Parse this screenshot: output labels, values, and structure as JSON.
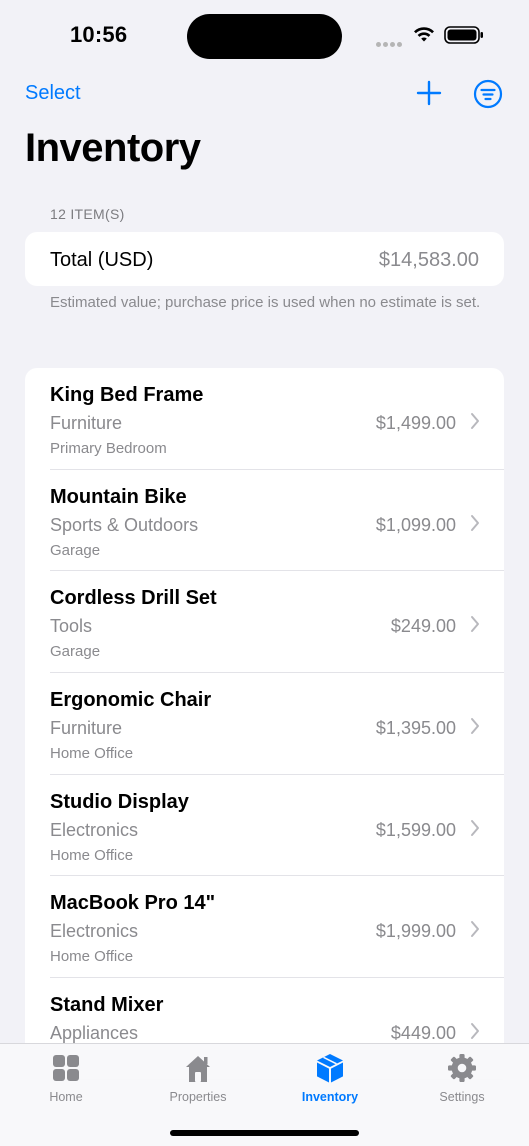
{
  "status_bar": {
    "time": "10:56"
  },
  "nav": {
    "select_label": "Select",
    "title": "Inventory"
  },
  "summary": {
    "count_label": "12 ITEM(S)",
    "total_label": "Total (USD)",
    "total_value": "$14,583.00",
    "footnote": "Estimated value; purchase price is used when no estimate is set."
  },
  "items": [
    {
      "name": "King Bed Frame",
      "category": "Furniture",
      "location": "Primary Bedroom",
      "price": "$1,499.00"
    },
    {
      "name": "Mountain Bike",
      "category": "Sports & Outdoors",
      "location": "Garage",
      "price": "$1,099.00"
    },
    {
      "name": "Cordless Drill Set",
      "category": "Tools",
      "location": "Garage",
      "price": "$249.00"
    },
    {
      "name": "Ergonomic Chair",
      "category": "Furniture",
      "location": "Home Office",
      "price": "$1,395.00"
    },
    {
      "name": "Studio Display",
      "category": "Electronics",
      "location": "Home Office",
      "price": "$1,599.00"
    },
    {
      "name": "MacBook Pro 14\"",
      "category": "Electronics",
      "location": "Home Office",
      "price": "$1,999.00"
    },
    {
      "name": "Stand Mixer",
      "category": "Appliances",
      "location": "",
      "price": "$449.00"
    }
  ],
  "tabs": [
    {
      "label": "Home",
      "icon": "grid-icon",
      "active": false
    },
    {
      "label": "Properties",
      "icon": "house-icon",
      "active": false
    },
    {
      "label": "Inventory",
      "icon": "shipping-box-icon",
      "active": true
    },
    {
      "label": "Settings",
      "icon": "gear-icon",
      "active": false
    }
  ],
  "colors": {
    "accent": "#007aff",
    "background": "#f2f2f7",
    "secondary_text": "#8a8a8e"
  }
}
